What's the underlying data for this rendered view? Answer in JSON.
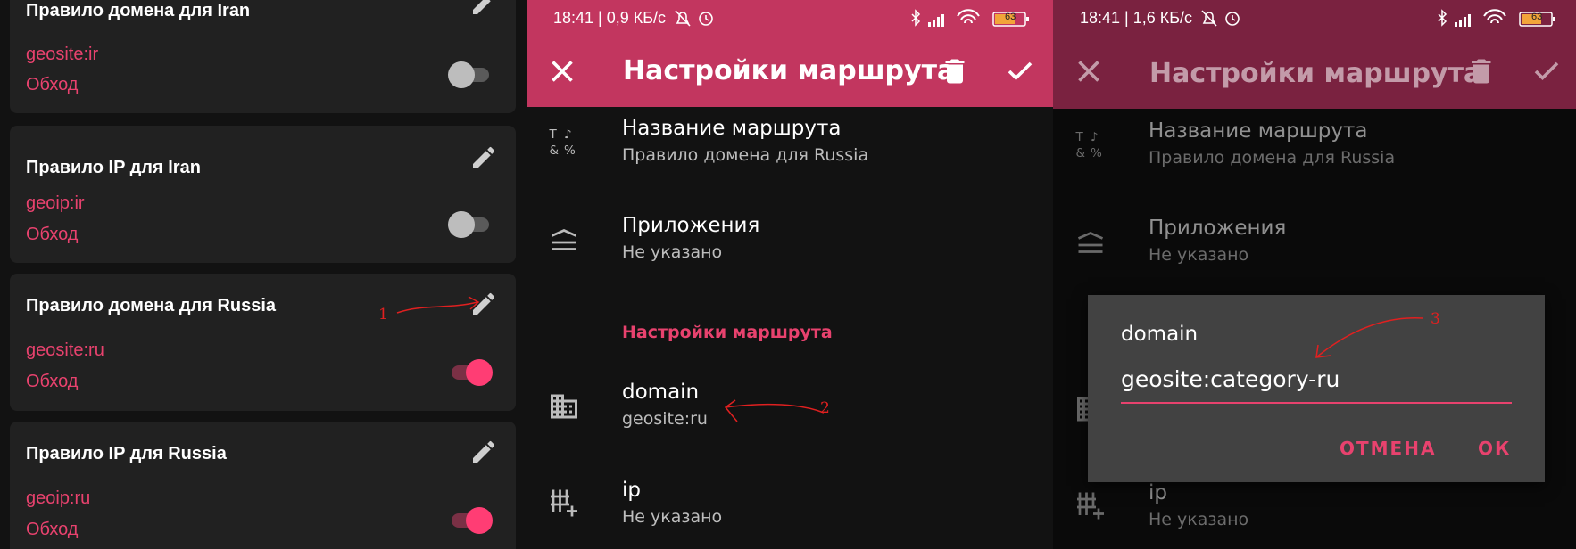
{
  "left_panel": {
    "cards": [
      {
        "title": "Правило домена для Iran",
        "value": "geosite:ir",
        "action": "Обход",
        "enabled": false
      },
      {
        "title": "Правило IP для Iran",
        "value": "geoip:ir",
        "action": "Обход",
        "enabled": false
      },
      {
        "title": "Правило домена для Russia",
        "value": "geosite:ru",
        "action": "Обход",
        "enabled": true
      },
      {
        "title": "Правило IP для Russia",
        "value": "geoip:ru",
        "action": "Обход",
        "enabled": true
      }
    ],
    "annotation": "1"
  },
  "middle_panel": {
    "statusbar": {
      "text": "18:41 | 0,9 КБ/с",
      "battery": "63"
    },
    "appbar": {
      "title": "Настройки маршрута",
      "color": "#c2365f"
    },
    "rows": [
      {
        "title": "Название маршрута",
        "subtitle": "Правило домена для Russia"
      },
      {
        "title": "Приложения",
        "subtitle": "Не указано"
      }
    ],
    "section_header": "Настройки маршрута",
    "rows2": [
      {
        "title": "domain",
        "subtitle": "geosite:ru"
      },
      {
        "title": "ip",
        "subtitle": "Не указано"
      }
    ],
    "annotation": "2"
  },
  "right_panel": {
    "statusbar": {
      "text": "18:41 | 1,6 КБ/с",
      "battery": "63"
    },
    "appbar": {
      "title": "Настройки маршрута",
      "color": "#7a2240"
    },
    "rows": [
      {
        "title": "Название маршрута",
        "subtitle": "Правило домена для Russia"
      },
      {
        "title": "Приложения",
        "subtitle": "Не указано"
      },
      {
        "title": "ip",
        "subtitle": "Не указано"
      }
    ],
    "dialog": {
      "title": "domain",
      "input_value": "geosite:category-ru",
      "cancel_label": "ОТМЕНА",
      "ok_label": "ОК"
    },
    "annotation": "3"
  }
}
